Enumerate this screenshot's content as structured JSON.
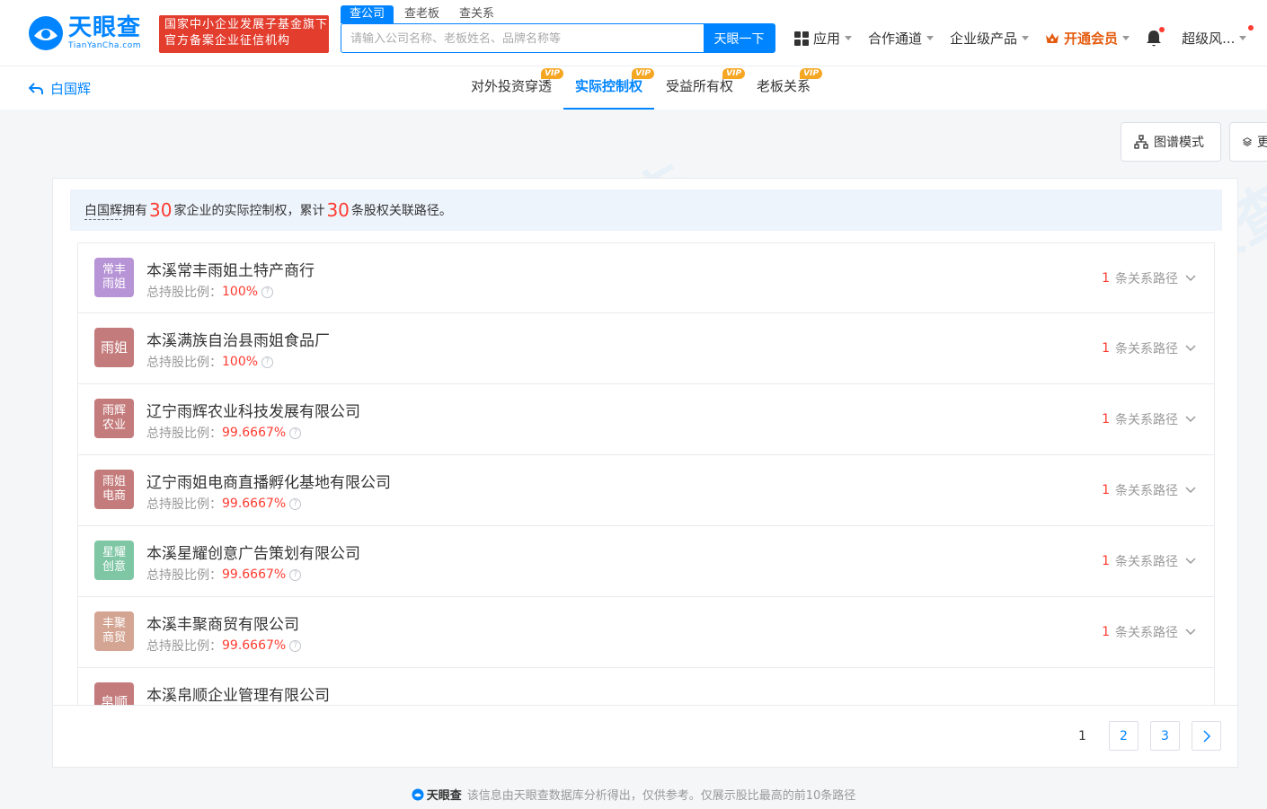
{
  "header": {
    "logo_cn": "天眼查",
    "logo_en": "TianYanCha.com",
    "gov_badge_line1": "国家中小企业发展子基金旗下",
    "gov_badge_line2": "官方备案企业征信机构",
    "search_tabs": [
      "查公司",
      "查老板",
      "查关系"
    ],
    "search_placeholder": "请输入公司名称、老板姓名、品牌名称等",
    "search_button": "天眼一下",
    "nav": {
      "apps": "应用",
      "channel": "合作通道",
      "enterprise": "企业级产品",
      "vip": "开通会员",
      "user": "超级风..."
    }
  },
  "subbar": {
    "back_label": "白国辉",
    "tabs": [
      {
        "label": "对外投资穿透",
        "badge": "VIP"
      },
      {
        "label": "实际控制权",
        "badge": "VIP"
      },
      {
        "label": "受益所有权",
        "badge": "VIP"
      },
      {
        "label": "老板关系",
        "badge": "VIP"
      }
    ]
  },
  "toolbar": {
    "graph_mode": "图谱模式",
    "other_mode": "更"
  },
  "summary": {
    "person": "白国辉",
    "own": "拥有",
    "company_count": "30",
    "mid": "家企业的实际控制权，累计",
    "path_count": "30",
    "tail": "条股权关联路径。"
  },
  "share_label": "总持股比例：",
  "path_label": "条关系路径",
  "companies": [
    {
      "avatar": "常丰雨姐",
      "color": "#b794d6",
      "name": "本溪常丰雨姐土特产商行",
      "share": "100%",
      "paths": "1"
    },
    {
      "avatar": "雨姐",
      "color": "#c47b7b",
      "name": "本溪满族自治县雨姐食品厂",
      "share": "100%",
      "paths": "1"
    },
    {
      "avatar": "雨辉农业",
      "color": "#c47b7b",
      "name": "辽宁雨辉农业科技发展有限公司",
      "share": "99.6667%",
      "paths": "1"
    },
    {
      "avatar": "雨姐电商",
      "color": "#c47b7b",
      "name": "辽宁雨姐电商直播孵化基地有限公司",
      "share": "99.6667%",
      "paths": "1"
    },
    {
      "avatar": "星耀创意",
      "color": "#7fc6a4",
      "name": "本溪星耀创意广告策划有限公司",
      "share": "99.6667%",
      "paths": "1"
    },
    {
      "avatar": "丰聚商贸",
      "color": "#d4a593",
      "name": "本溪丰聚商贸有限公司",
      "share": "99.6667%",
      "paths": "1"
    },
    {
      "avatar": "帛顺",
      "color": "#c47b7b",
      "name": "本溪帛顺企业管理有限公司",
      "share": "",
      "paths": ""
    }
  ],
  "pagination": {
    "pages": [
      "1",
      "2",
      "3"
    ],
    "current": "1"
  },
  "footer": {
    "brand": "天眼查",
    "note": "该信息由天眼查数据库分析得出，仅供参考。仅展示股比最高的前10条路径"
  },
  "colors": {
    "brand": "#0084ff",
    "accent_red": "#ff3b30",
    "gov_red": "#e33d2e",
    "vip_orange": "#f5a623"
  }
}
